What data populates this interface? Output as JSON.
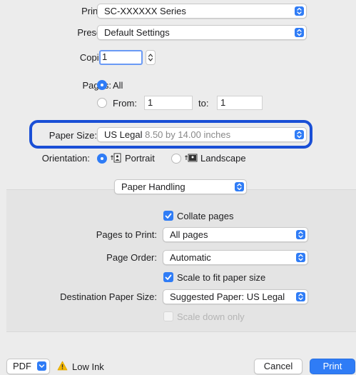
{
  "printer": {
    "label": "Printer:",
    "value": "SC-XXXXXX Series"
  },
  "presets": {
    "label": "Presets:",
    "value": "Default Settings"
  },
  "copies": {
    "label": "Copies:",
    "value": "1"
  },
  "pages": {
    "label": "Pages:",
    "all_label": "All",
    "from_label": "From:",
    "from_value": "1",
    "to_label": "to:",
    "to_value": "1",
    "selected": "All"
  },
  "paper_size": {
    "label": "Paper Size:",
    "value": "US Legal",
    "detail": "8.50 by 14.00 inches",
    "highlight_color": "#1a4fd6"
  },
  "orientation": {
    "label": "Orientation:",
    "portrait_label": "Portrait",
    "landscape_label": "Landscape",
    "selected": "Portrait"
  },
  "section": {
    "selector_value": "Paper Handling",
    "collate_label": "Collate pages",
    "collate_checked": true,
    "pages_to_print_label": "Pages to Print:",
    "pages_to_print_value": "All pages",
    "page_order_label": "Page Order:",
    "page_order_value": "Automatic",
    "scale_label": "Scale to fit paper size",
    "scale_checked": true,
    "destination_label": "Destination Paper Size:",
    "destination_value": "Suggested Paper: US Legal",
    "scale_down_label": "Scale down only",
    "scale_down_checked": false,
    "scale_down_enabled": false
  },
  "footer": {
    "pdf_label": "PDF",
    "warning_label": "Low Ink",
    "warning_color": "#f5b800",
    "cancel_label": "Cancel",
    "print_label": "Print",
    "accent_color": "#2f7cf6"
  }
}
